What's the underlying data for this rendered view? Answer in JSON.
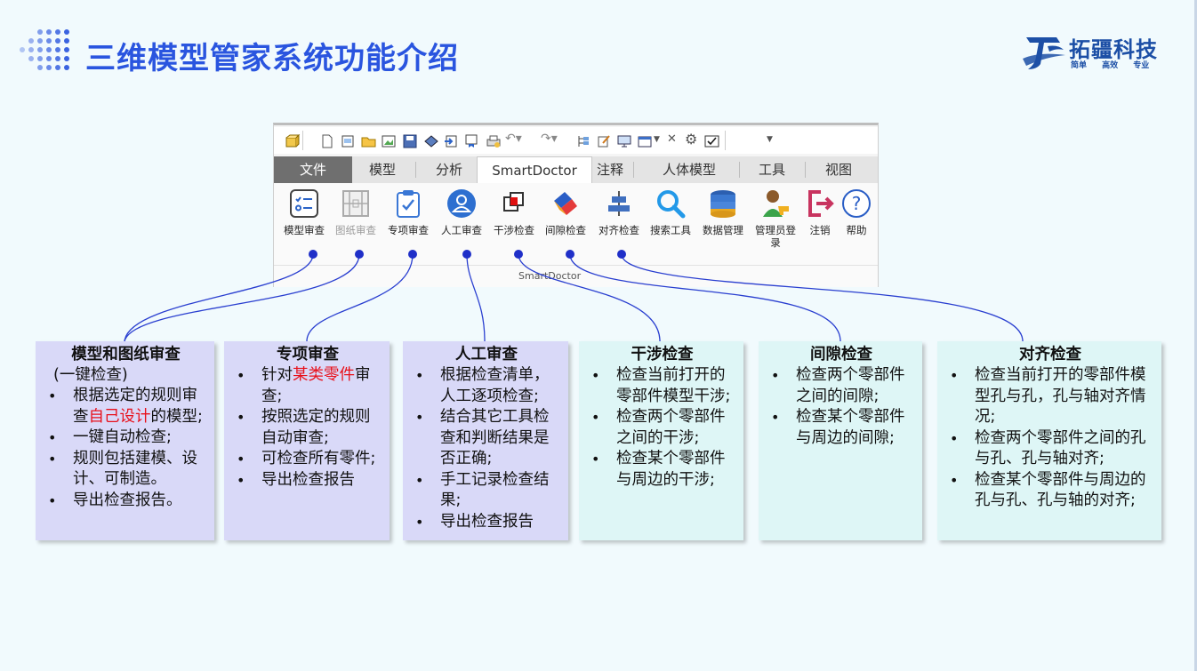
{
  "header": {
    "title": "三维模型管家系统功能介绍",
    "logo_name": "拓疆科技",
    "logo_slogan": "简单 高效 专业"
  },
  "ribbon": {
    "tabs": [
      "文件",
      "模型",
      "分析",
      "SmartDoctor",
      "注释",
      "人体模型",
      "工具",
      "视图"
    ],
    "active_tab": "SmartDoctor",
    "tools": [
      {
        "label": "模型审查",
        "icon": "checklist-icon"
      },
      {
        "label": "图纸审查",
        "icon": "drawing-icon"
      },
      {
        "label": "专项审查",
        "icon": "clipboard-check-icon"
      },
      {
        "label": "人工审查",
        "icon": "user-review-icon"
      },
      {
        "label": "干涉检查",
        "icon": "interference-icon"
      },
      {
        "label": "间隙检查",
        "icon": "clearance-icon"
      },
      {
        "label": "对齐检查",
        "icon": "align-icon"
      },
      {
        "label": "搜索工具",
        "icon": "search-icon"
      },
      {
        "label": "数据管理",
        "icon": "database-icon"
      },
      {
        "label": "管理员登录",
        "icon": "admin-icon"
      },
      {
        "label": "注销",
        "icon": "logout-icon"
      },
      {
        "label": "帮助",
        "icon": "help-icon"
      }
    ],
    "group_label": "SmartDoctor"
  },
  "cards": [
    {
      "title": "模型和图纸审查",
      "subtitle": "(一键检查)",
      "items": [
        {
          "pre": "根据选定的规则审查",
          "hl": "自己设计",
          "post": "的模型;"
        },
        {
          "pre": "一键自动检查;",
          "hl": "",
          "post": ""
        },
        {
          "pre": "规则包括建模、设计、可制造。",
          "hl": "",
          "post": ""
        },
        {
          "pre": "导出检查报告。",
          "hl": "",
          "post": ""
        }
      ]
    },
    {
      "title": "专项审查",
      "items": [
        {
          "pre": "针对",
          "hl": "某类零件",
          "post": "审查;"
        },
        {
          "pre": "按照选定的规则自动审查;",
          "hl": "",
          "post": ""
        },
        {
          "pre": "可检查所有零件;",
          "hl": "",
          "post": ""
        },
        {
          "pre": "导出检查报告",
          "hl": "",
          "post": ""
        }
      ]
    },
    {
      "title": "人工审查",
      "items": [
        {
          "pre": "根据检查清单，人工逐项检查;",
          "hl": "",
          "post": ""
        },
        {
          "pre": "结合其它工具检查和判断结果是否正确;",
          "hl": "",
          "post": ""
        },
        {
          "pre": "手工记录检查结果;",
          "hl": "",
          "post": ""
        },
        {
          "pre": "导出检查报告",
          "hl": "",
          "post": ""
        }
      ]
    },
    {
      "title": "干涉检查",
      "items": [
        {
          "pre": "检查当前打开的零部件模型干涉;",
          "hl": "",
          "post": ""
        },
        {
          "pre": "检查两个零部件之间的干涉;",
          "hl": "",
          "post": ""
        },
        {
          "pre": "检查某个零部件与周边的干涉;",
          "hl": "",
          "post": ""
        }
      ]
    },
    {
      "title": "间隙检查",
      "items": [
        {
          "pre": "检查两个零部件之间的间隙;",
          "hl": "",
          "post": ""
        },
        {
          "pre": "检查某个零部件与周边的间隙;",
          "hl": "",
          "post": ""
        }
      ]
    },
    {
      "title": "对齐检查",
      "items": [
        {
          "pre": "检查当前打开的零部件模型孔与孔，孔与轴对齐情况;",
          "hl": "",
          "post": ""
        },
        {
          "pre": "检查两个零部件之间的孔与孔、孔与轴对齐;",
          "hl": "",
          "post": ""
        },
        {
          "pre": "检查某个零部件与周边的孔与孔、孔与轴的对齐;",
          "hl": "",
          "post": ""
        }
      ]
    }
  ],
  "colors": {
    "title_blue": "#2a55df",
    "card_purple": "#d9d9f8",
    "card_cyan": "#def6f6",
    "highlight_red": "#e8101a",
    "connector_blue": "#2a3fd0"
  }
}
